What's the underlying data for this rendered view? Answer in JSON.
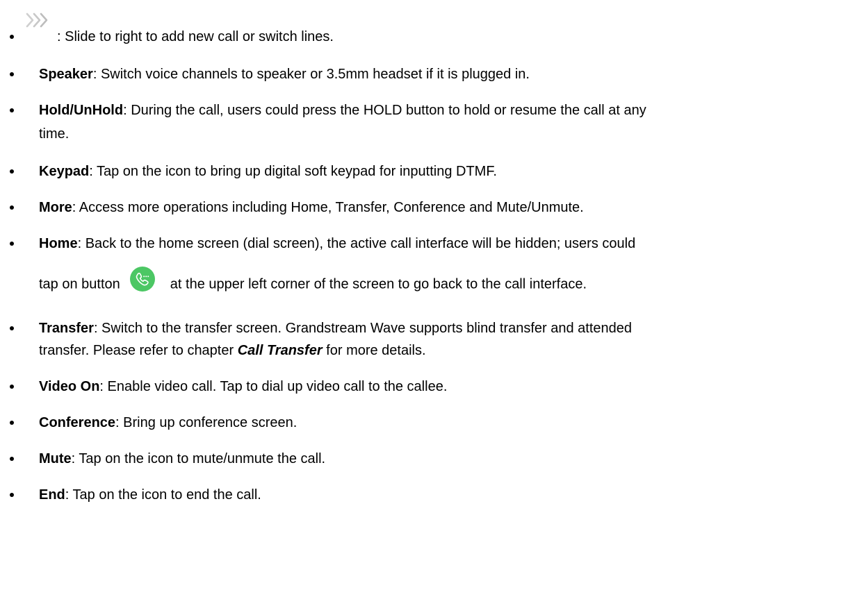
{
  "items": [
    {
      "term": "",
      "text": ": Slide to right to add new call or switch lines.",
      "icon": "chevron-double-right-icon"
    },
    {
      "term": "Speaker",
      "text": ": Switch voice channels to speaker or 3.5mm headset if it is plugged in."
    },
    {
      "term": "Hold/UnHold",
      "text": ": During the call, users could press the HOLD button to hold or resume the call at any",
      "text_line2": "time."
    },
    {
      "term": "Keypad",
      "text": ": Tap on the icon to bring up digital soft keypad for inputting DTMF."
    },
    {
      "term": "More",
      "text": ": Access more operations including Home, Transfer, Conference and Mute/Unmute."
    },
    {
      "term": "Home",
      "text": ": Back to the home screen (dial screen), the active call interface will be hidden; users could",
      "text_line2_pre": "tap on button",
      "text_line2_post": "at the upper left corner of the screen to go back to the call interface.",
      "icon": "call-bubble-icon",
      "icon_color": "#4cc764"
    },
    {
      "term": "Transfer",
      "text": ": Switch to the transfer screen. Grandstream Wave supports blind transfer and attended",
      "text_line2_pre": "transfer. Please refer to chapter ",
      "text_line2_ref": "Call Transfer",
      "text_line2_post": " for more details."
    },
    {
      "term": "Video On",
      "text": ": Enable video call. Tap to dial up video call to the callee."
    },
    {
      "term": "Conference",
      "text": ": Bring up conference screen."
    },
    {
      "term": "Mute",
      "text": ": Tap on the icon to mute/unmute the call."
    },
    {
      "term": "End",
      "text": ": Tap on the icon to end the call."
    }
  ]
}
